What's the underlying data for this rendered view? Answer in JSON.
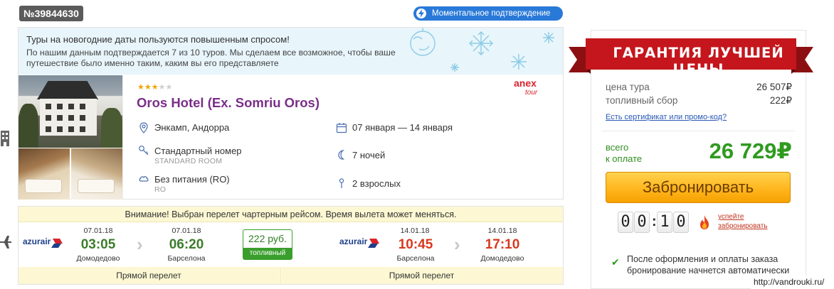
{
  "order": {
    "number": "№39844630"
  },
  "badges": {
    "instant_confirmation": "Моментальное подтверждение"
  },
  "notice": {
    "title": "Туры на новогодние даты пользуются повышенным спросом!",
    "text": "По нашим данным подтверждается 7 из 10 туров. Мы сделаем все возможное, чтобы ваше путешествие было именно таким, каким вы его представляете"
  },
  "hotel": {
    "stars": 3,
    "stars_max": 5,
    "name": "Oros Hotel (Ex. Somriu Oros)",
    "operator": {
      "line1": "anex",
      "line2": "tour"
    },
    "location": "Энкамп, Андорра",
    "dates": "07 января — 14 января",
    "room": "Стандартный номер",
    "room_sub": "STANDARD ROOM",
    "nights": "7 ночей",
    "meal": "Без питания (RO)",
    "meal_sub": "RO",
    "guests": "2 взрослых"
  },
  "flights": {
    "warning": "Внимание! Выбран перелет чартерным рейсом. Время вылета может меняться.",
    "fuel": {
      "amount": "222 руб.",
      "label": "топливный сбор"
    },
    "outbound": {
      "airline": "azurair",
      "dep_date": "07.01.18",
      "dep_time": "03:05",
      "dep_city": "Домодедово",
      "arr_date": "07.01.18",
      "arr_time": "06:20",
      "arr_city": "Барселона",
      "type": "Прямой перелет"
    },
    "inbound": {
      "airline": "azurair",
      "dep_date": "14.01.18",
      "dep_time": "10:45",
      "dep_city": "Барселона",
      "arr_date": "14.01.18",
      "arr_time": "17:10",
      "arr_city": "Домодедово",
      "type": "Прямой перелет"
    }
  },
  "pricing": {
    "guarantee": "ГАРАНТИЯ ЛУЧШЕЙ ЦЕНЫ",
    "tour_label": "цена тура",
    "tour_value": "26 507₽",
    "fuel_label": "топливный сбор",
    "fuel_value": "222₽",
    "promo": "Есть сертификат или промо-код?",
    "total_label_1": "всего",
    "total_label_2": "к оплате",
    "total_value": "26 729₽",
    "book_button": "Забронировать"
  },
  "timer": {
    "digits": [
      "0",
      "0",
      "1",
      "0"
    ],
    "hurry_1": "успейте",
    "hurry_2": "забронировать"
  },
  "confirmation_note": "После оформления и оплаты заказа бронирование начнется автоматически",
  "watermark": "http://vandrouki.ru/",
  "colors": {
    "purple": "#7a2e88",
    "green": "#2f9a1f",
    "red": "#d9381e",
    "blue": "#2979d8",
    "ribbon": "#c4161c"
  }
}
